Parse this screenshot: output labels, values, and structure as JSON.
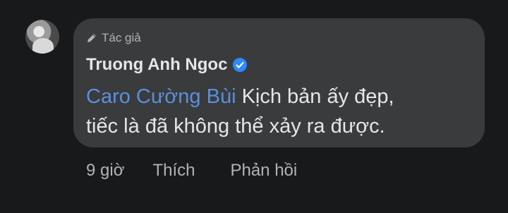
{
  "comment": {
    "author_badge": "Tác giả",
    "author_name": "Truong Anh Ngoc",
    "mention": "Caro Cường Bùi",
    "text_line1": " Kịch bản ấy đẹp,",
    "text_line2": "tiếc là đã không thể xảy ra được.",
    "icons": {
      "badge_icon": "pencil-icon",
      "verified_icon": "verified-badge-icon",
      "avatar": "user-avatar"
    },
    "colors": {
      "mention": "#5b8fde",
      "verified": "#2d88ff",
      "bubble": "#3a3b3c"
    }
  },
  "actions": {
    "time": "9 giờ",
    "like": "Thích",
    "reply": "Phản hồi"
  }
}
